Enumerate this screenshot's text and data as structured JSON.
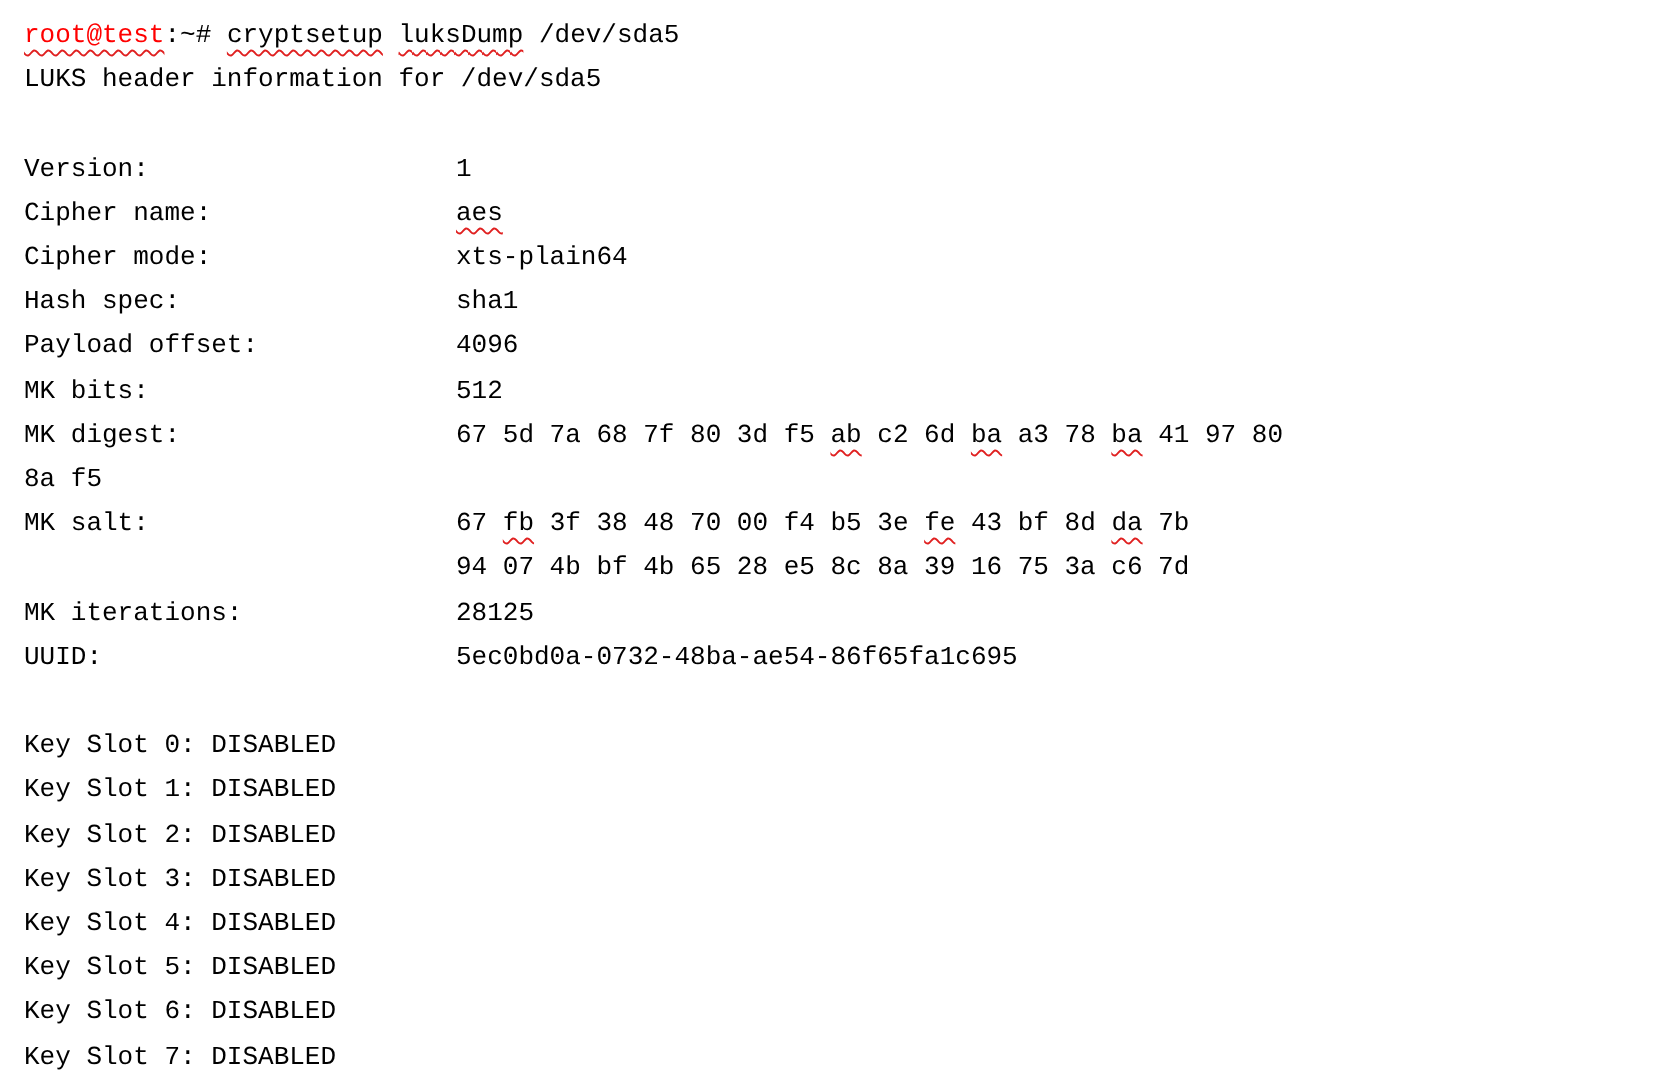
{
  "command": [
    {
      "text": "root@test",
      "kind": "user",
      "flagged": true
    },
    {
      "text": ":~# ",
      "kind": "plain",
      "flagged": false
    },
    {
      "text": "cryptsetup",
      "kind": "plain",
      "flagged": true
    },
    {
      "text": "luksDump",
      "kind": "plain",
      "flagged": true
    },
    {
      "text": " /dev/sda5",
      "kind": "plain",
      "flagged": false
    }
  ],
  "heading": "LUKS header information for /dev/sda5",
  "fields": [
    {
      "label": "Version:",
      "value_lines": [
        [
          {
            "text": "1",
            "flagged": false
          }
        ]
      ]
    },
    {
      "label": "Cipher name:",
      "value_lines": [
        [
          {
            "text": "aes",
            "flagged": true
          }
        ]
      ]
    },
    {
      "label": "Cipher mode:",
      "value_lines": [
        [
          {
            "text": "xts-plain64",
            "flagged": false
          }
        ]
      ]
    },
    {
      "label": "Hash spec:",
      "value_lines": [
        [
          {
            "text": "sha1",
            "flagged": false
          }
        ]
      ]
    },
    {
      "label": "Payload offset:",
      "value_lines": [
        [
          {
            "text": "4096",
            "flagged": false
          }
        ]
      ]
    },
    {
      "label": "MK bits:",
      "value_lines": [
        [
          {
            "text": "512",
            "flagged": false
          }
        ]
      ]
    },
    {
      "label": "MK digest:",
      "value_lines": [
        [
          {
            "text": "67 5d 7a 68 7f 80 3d f5 ",
            "flagged": false
          },
          {
            "text": "ab",
            "flagged": true
          },
          {
            "text": " c2 6d ",
            "flagged": false
          },
          {
            "text": "ba",
            "flagged": true
          },
          {
            "text": " a3 78 ",
            "flagged": false
          },
          {
            "text": "ba",
            "flagged": true
          },
          {
            "text": " 41 97 80",
            "flagged": false
          }
        ]
      ],
      "overflow": [
        {
          "text": "8a f5",
          "flagged": false
        }
      ]
    },
    {
      "label": "MK salt:",
      "value_lines": [
        [
          {
            "text": "67 ",
            "flagged": false
          },
          {
            "text": "fb",
            "flagged": true
          },
          {
            "text": " 3f 38 48 70 00 f4 b5 3e ",
            "flagged": false
          },
          {
            "text": "fe",
            "flagged": true
          },
          {
            "text": " 43 bf 8d ",
            "flagged": false
          },
          {
            "text": "da",
            "flagged": true
          },
          {
            "text": " 7b",
            "flagged": false
          }
        ],
        [
          {
            "text": "94 07 4b bf 4b 65 28 e5 8c 8a 39 16 75 3a c6 7d",
            "flagged": false
          }
        ]
      ]
    },
    {
      "label": "MK iterations:",
      "value_lines": [
        [
          {
            "text": "28125",
            "flagged": false
          }
        ]
      ]
    },
    {
      "label": "UUID:",
      "value_lines": [
        [
          {
            "text": "5ec0bd0a-0732-48ba-ae54-86f65fa1c695",
            "flagged": false
          }
        ]
      ]
    }
  ],
  "key_slots": [
    "Key Slot 0: DISABLED",
    "Key Slot 1: DISABLED",
    "Key Slot 2: DISABLED",
    "Key Slot 3: DISABLED",
    "Key Slot 4: DISABLED",
    "Key Slot 5: DISABLED",
    "Key Slot 6: DISABLED",
    "Key Slot 7: DISABLED"
  ]
}
